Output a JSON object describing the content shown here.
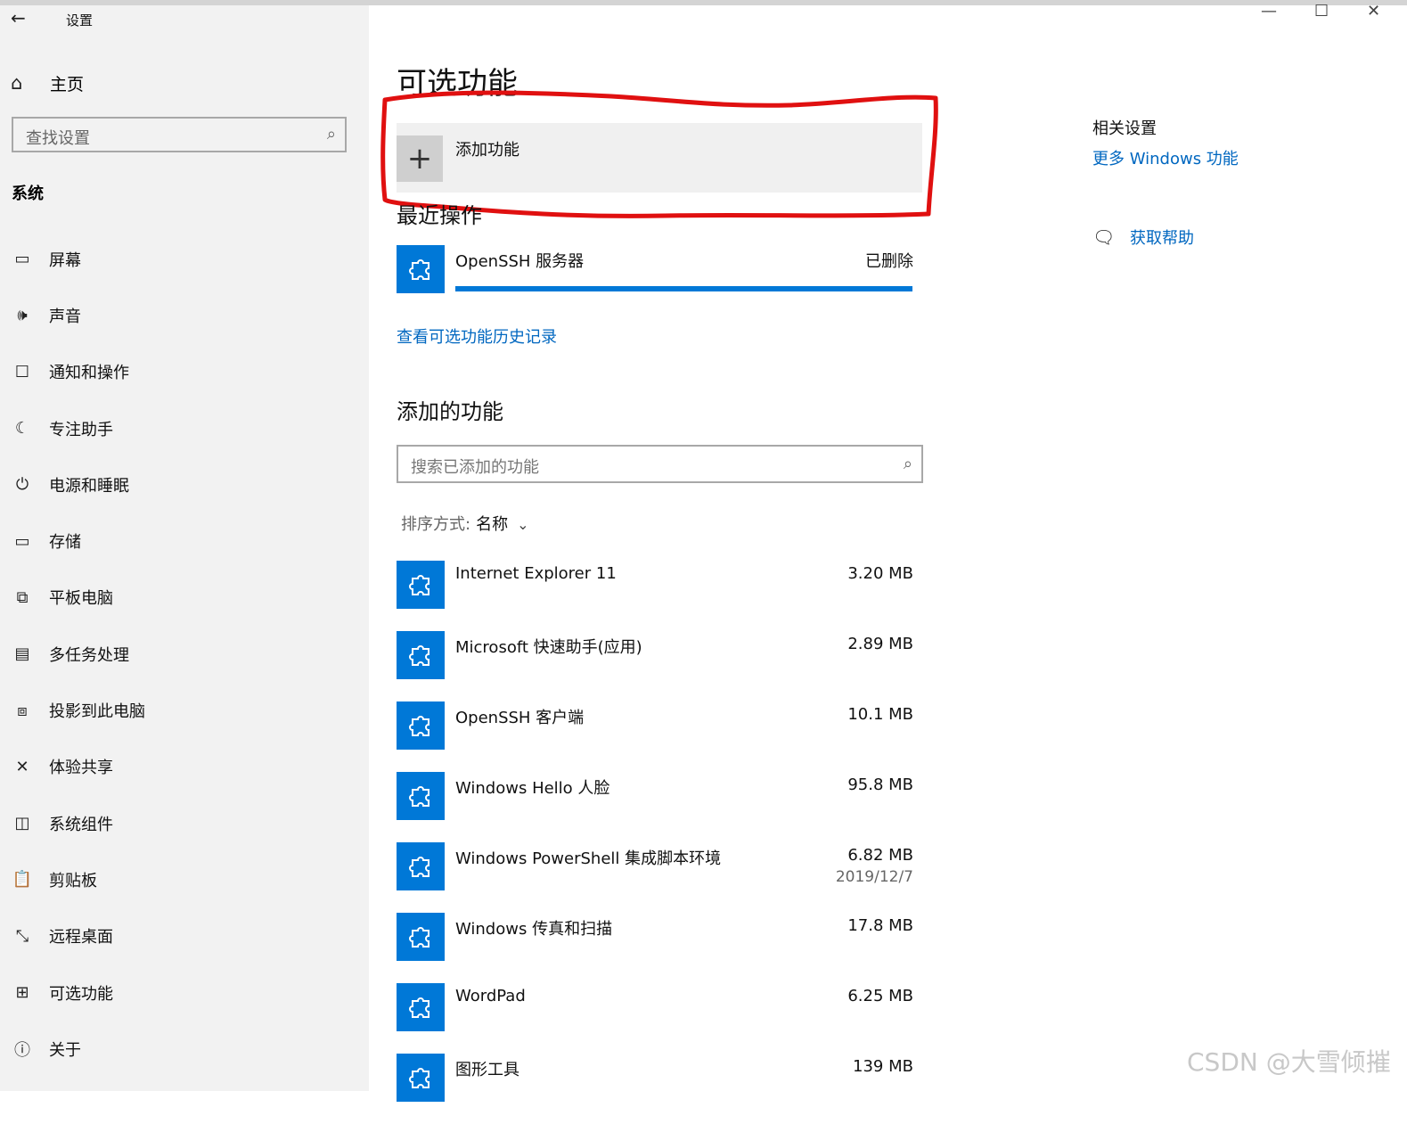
{
  "window": {
    "title": "设置",
    "back_icon": "arrow-left-icon",
    "controls": [
      "minimize-icon",
      "maximize-icon",
      "close-icon"
    ]
  },
  "sidebar": {
    "home_label": "主页",
    "search_placeholder": "查找设置",
    "section_label": "系统",
    "items": [
      {
        "label": "屏幕",
        "icon": "monitor-icon"
      },
      {
        "label": "声音",
        "icon": "speaker-icon"
      },
      {
        "label": "通知和操作",
        "icon": "notification-icon"
      },
      {
        "label": "专注助手",
        "icon": "moon-icon"
      },
      {
        "label": "电源和睡眠",
        "icon": "power-icon"
      },
      {
        "label": "存储",
        "icon": "storage-icon"
      },
      {
        "label": "平板电脑",
        "icon": "tablet-icon"
      },
      {
        "label": "多任务处理",
        "icon": "multitask-icon"
      },
      {
        "label": "投影到此电脑",
        "icon": "project-icon"
      },
      {
        "label": "体验共享",
        "icon": "share-icon"
      },
      {
        "label": "系统组件",
        "icon": "components-icon"
      },
      {
        "label": "剪贴板",
        "icon": "clipboard-icon"
      },
      {
        "label": "远程桌面",
        "icon": "remote-desktop-icon"
      },
      {
        "label": "可选功能",
        "icon": "optional-features-icon"
      },
      {
        "label": "关于",
        "icon": "info-icon"
      }
    ]
  },
  "main": {
    "title": "可选功能",
    "add_feature_label": "添加功能",
    "recent_heading": "最近操作",
    "recent": {
      "name": "OpenSSH 服务器",
      "status": "已删除",
      "progress": 1.0
    },
    "history_link": "查看可选功能历史记录",
    "added_heading": "添加的功能",
    "search_placeholder": "搜索已添加的功能",
    "sort_label": "排序方式:",
    "sort_value": "名称",
    "features": [
      {
        "name": "Internet Explorer 11",
        "size": "3.20 MB",
        "date": ""
      },
      {
        "name": "Microsoft 快速助手(应用)",
        "size": "2.89 MB",
        "date": ""
      },
      {
        "name": "OpenSSH 客户端",
        "size": "10.1 MB",
        "date": ""
      },
      {
        "name": "Windows Hello 人脸",
        "size": "95.8 MB",
        "date": ""
      },
      {
        "name": "Windows PowerShell 集成脚本环境",
        "size": "6.82 MB",
        "date": "2019/12/7"
      },
      {
        "name": "Windows 传真和扫描",
        "size": "17.8 MB",
        "date": ""
      },
      {
        "name": "WordPad",
        "size": "6.25 MB",
        "date": ""
      },
      {
        "name": "图形工具",
        "size": "139 MB",
        "date": ""
      }
    ]
  },
  "related": {
    "title": "相关设置",
    "more_link": "更多 Windows 功能",
    "help_label": "获取帮助"
  },
  "watermark": "CSDN @大雪倾摧",
  "colors": {
    "accent": "#0078d7",
    "link": "#0067c0",
    "sidebar_bg": "#f2f2f2",
    "annotation": "#e01010"
  }
}
